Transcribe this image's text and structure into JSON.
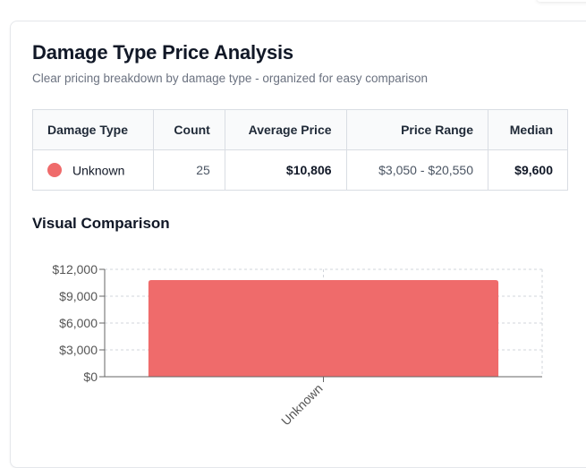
{
  "header": {
    "title": "Damage Type Price Analysis",
    "subtitle": "Clear pricing breakdown by damage type - organized for easy comparison"
  },
  "table": {
    "columns": [
      "Damage Type",
      "Count",
      "Average Price",
      "Price Range",
      "Median"
    ],
    "rows": [
      {
        "damage_type": "Unknown",
        "color": "#ef6b6b",
        "count": "25",
        "average_price": "$10,806",
        "price_range": "$3,050 - $20,550",
        "median": "$9,600"
      }
    ]
  },
  "chart_section": {
    "title": "Visual Comparison"
  },
  "chart_data": {
    "type": "bar",
    "categories": [
      "Unknown"
    ],
    "values": [
      10806
    ],
    "ylim": [
      0,
      12000
    ],
    "yticks": [
      0,
      3000,
      6000,
      9000,
      12000
    ],
    "ytick_labels": [
      "$0",
      "$3,000",
      "$6,000",
      "$9,000",
      "$12,000"
    ],
    "grid": true,
    "bar_color": "#ef6b6b",
    "xlabel": "",
    "ylabel": ""
  }
}
